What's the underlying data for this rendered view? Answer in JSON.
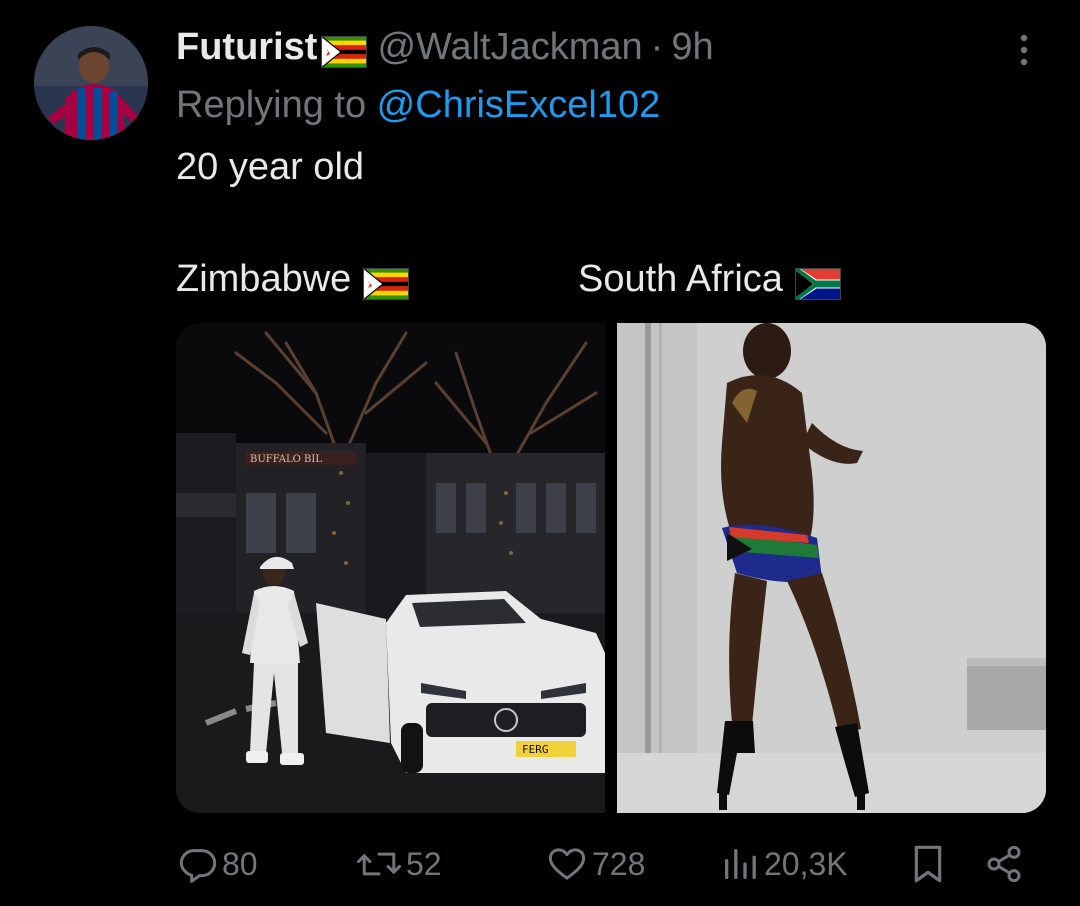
{
  "tweet": {
    "display_name": "Futurist",
    "handle": "@WaltJackman",
    "separator": "·",
    "time": "9h",
    "replying_prefix": "Replying to ",
    "replying_to": "@ChrisExcel102",
    "text": "20 year old"
  },
  "media": {
    "left_caption": "Zimbabwe",
    "right_caption": "South Africa",
    "left_image_text": {
      "shop_sign": "BUFFALO BIL",
      "plate": "FERG"
    }
  },
  "actions": {
    "replies": "80",
    "reposts": "52",
    "likes": "728",
    "views": "20,3K"
  },
  "icons": {
    "flag_header": "zimbabwe-flag-icon",
    "flag_left": "zimbabwe-flag-icon",
    "flag_right": "south-africa-flag-icon",
    "more": "more-vertical-icon",
    "reply": "reply-icon",
    "repost": "repost-icon",
    "like": "heart-icon",
    "views": "views-icon",
    "bookmark": "bookmark-icon",
    "share": "share-icon"
  },
  "colors": {
    "background": "#000000",
    "text_primary": "#e7e9ea",
    "text_secondary": "#71767b",
    "accent": "#1d9bf0"
  }
}
